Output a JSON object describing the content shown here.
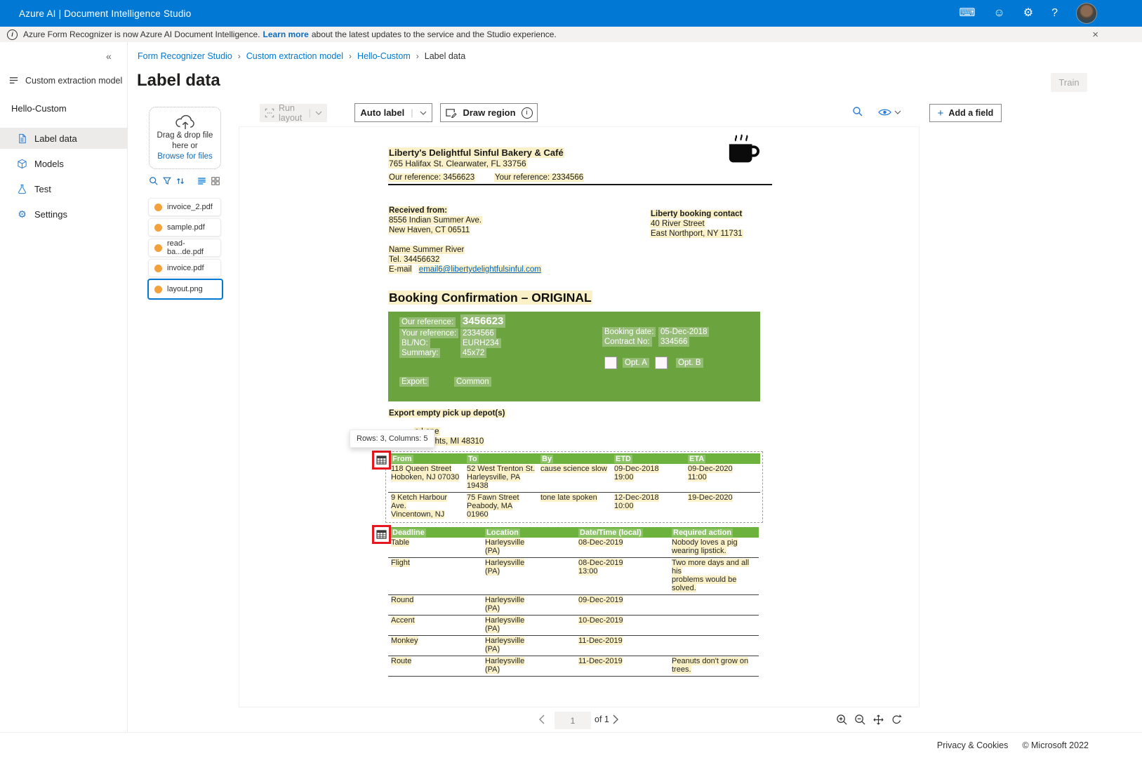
{
  "app": {
    "title": "Azure AI | Document Intelligence Studio"
  },
  "icons": {
    "keyboard": "⌨",
    "smiley": "☺",
    "gear": "⚙",
    "help": "?",
    "close": "×",
    "collapse": "«",
    "chevron_right": "›",
    "plus": "+"
  },
  "banner": {
    "text_before": "Azure Form Recognizer is now Azure AI Document Intelligence.",
    "link_text": "Learn more",
    "text_after": "about the latest updates to the service and the Studio experience."
  },
  "breadcrumb": {
    "items": [
      "Form Recognizer Studio",
      "Custom extraction model",
      "Hello-Custom",
      "Label data"
    ]
  },
  "sidebar": {
    "section_label": "Custom extraction model",
    "project_name": "Hello-Custom",
    "items": [
      {
        "label": "Label data"
      },
      {
        "label": "Models"
      },
      {
        "label": "Test"
      },
      {
        "label": "Settings"
      }
    ]
  },
  "page": {
    "title": "Label data",
    "train_label": "Train"
  },
  "file_panel": {
    "dropzone": {
      "line1": "Drag & drop file",
      "line2": "here or",
      "browse_label": "Browse for files"
    },
    "files": [
      {
        "name": "invoice_2.pdf"
      },
      {
        "name": "sample.pdf"
      },
      {
        "name": "read-ba...de.pdf"
      },
      {
        "name": "invoice.pdf"
      },
      {
        "name": "layout.png"
      }
    ],
    "selected_file": "layout.png"
  },
  "toolbar": {
    "run_layout_label": "Run layout",
    "auto_label_label": "Auto label",
    "draw_region_label": "Draw region"
  },
  "fields_panel": {
    "add_field_label": "Add a field"
  },
  "tooltip": {
    "text": "Rows: 3, Columns: 5"
  },
  "pagination": {
    "current_page": "1",
    "of_label": "of 1"
  },
  "footer": {
    "privacy_label": "Privacy & Cookies",
    "copyright": "© Microsoft 2022"
  },
  "colors": {
    "accent": "#0078d4",
    "doc_green": "#6BA33F",
    "highlight_yellow": "#FAF1C8",
    "marker_red": "#E8161E"
  },
  "document": {
    "company_name": "Liberty's Delightful Sinful Bakery & Café",
    "company_address": "765 Halifax St. Clearwater, FL 33756",
    "our_reference_line": "Our reference: 3456623",
    "your_reference_line": "Your reference: 2334566",
    "received_from": {
      "title": "Received from:",
      "address1": "8556 Indian Summer Ave.",
      "address2": "New Haven, CT 06511"
    },
    "booking_contact": {
      "title": "Liberty booking contact",
      "address1": "40 River Street",
      "address2": "East Northport, NY 11731"
    },
    "contact_person": {
      "name_line": "Name Summer River",
      "tel_line": "Tel. 34456632",
      "email_label": "E-mail",
      "email": "email6@libertydelightfulsinful.com"
    },
    "booking_title": "Booking Confirmation – ORIGINAL",
    "booking_box": {
      "left_fields": [
        {
          "label": "Our reference:",
          "value": "3456623"
        },
        {
          "label": "Your reference:",
          "value": "2334566"
        },
        {
          "label": "BL/NO:",
          "value": "EURH234"
        },
        {
          "label": "Summary:",
          "value": "45x72"
        }
      ],
      "right_fields": [
        {
          "label": "Booking date:",
          "value": "05-Dec-2018"
        },
        {
          "label": "Contract No:",
          "value": "334566"
        }
      ],
      "checkboxes": [
        {
          "label": "Opt. A"
        },
        {
          "label": "Opt. B"
        }
      ],
      "export_label": "Export:",
      "export_value": "Common"
    },
    "depot_heading": "Export empty pick up depot(s)",
    "depot_partial_line1": "s Lane",
    "depot_partial_line2": "Heights, MI 48310",
    "table1": {
      "headers": [
        "From",
        "To",
        "By",
        "ETD",
        "ETA"
      ],
      "rows": [
        [
          "118 Queen Street\nHoboken, NJ 07030",
          "52 West Trenton St.\nHarleysville, PA\n19438",
          "cause science slow",
          "09-Dec-2018\n19:00",
          "09-Dec-2020\n11:00"
        ],
        [
          "9 Ketch Harbour\nAve.\nVincentown, NJ",
          "75 Fawn Street\nPeabody, MA 01960",
          "tone late spoken",
          "12-Dec-2018\n10:00",
          "19-Dec-2020"
        ]
      ]
    },
    "table2": {
      "headers": [
        "Deadline",
        "Location",
        "Date/Time (local)",
        "Required action"
      ],
      "rows": [
        [
          "Table",
          "Harleysville\n(PA)",
          "08-Dec-2019",
          "Nobody loves a pig\nwearing lipstick."
        ],
        [
          "Flight",
          "Harleysville\n(PA)",
          "08-Dec-2019\n13:00",
          "Two more days and all his\nproblems would be solved."
        ],
        [
          "Round",
          "Harleysville\n(PA)",
          "09-Dec-2019",
          ""
        ],
        [
          "Accent",
          "Harleysville\n(PA)",
          "10-Dec-2019",
          ""
        ],
        [
          "Monkey",
          "Harleysville\n(PA)",
          "11-Dec-2019",
          ""
        ],
        [
          "Route",
          "Harleysville\n(PA)",
          "11-Dec-2019",
          "Peanuts don't grow on\ntrees."
        ]
      ]
    }
  }
}
